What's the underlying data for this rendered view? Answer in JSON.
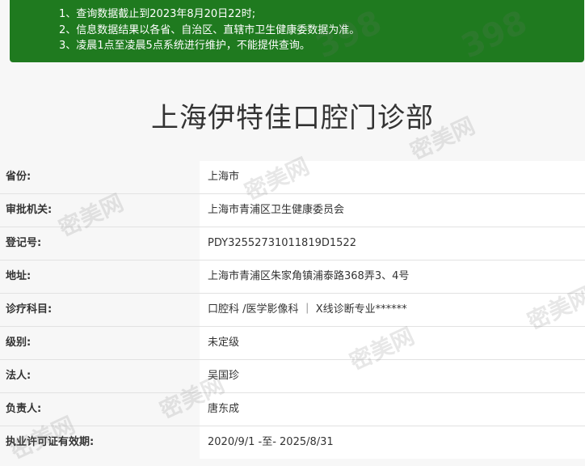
{
  "notice": {
    "lines": [
      "1、查询数据截止到2023年8月20日22时;",
      "2、信息数据结果以各省、自治区、直辖市卫生健康委数据为准。",
      "3、凌晨1点至凌晨5点系统进行维护，不能提供查询。"
    ]
  },
  "title": "上海伊特佳口腔门诊部",
  "rows": [
    {
      "label": "省份:",
      "value": "上海市"
    },
    {
      "label": "审批机关:",
      "value": "上海市青浦区卫生健康委员会"
    },
    {
      "label": "登记号:",
      "value": "PDY32552731011819D1522"
    },
    {
      "label": "地址:",
      "value": "上海市青浦区朱家角镇浦泰路368弄3、4号"
    },
    {
      "label": "诊疗科目:",
      "value": "口腔科 /医学影像科 ｜ X线诊断专业******"
    },
    {
      "label": "级别:",
      "value": "未定级"
    },
    {
      "label": "法人:",
      "value": "吴国珍"
    },
    {
      "label": "负责人:",
      "value": "唐东成"
    },
    {
      "label": "执业许可证有效期:",
      "value": "2020/9/1 -至- 2025/8/31"
    }
  ],
  "watermark": {
    "text": "密美网",
    "logo": "398"
  }
}
